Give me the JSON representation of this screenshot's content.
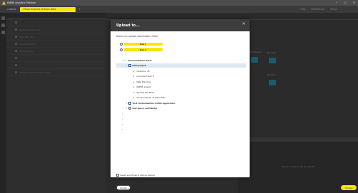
{
  "app": {
    "title": "KNIME Analytics Platform",
    "window_controls": [
      "–",
      "□",
      "✕"
    ]
  },
  "tabbar": {
    "home": "⌂ Home",
    "active_tab": "Visual Analysis of Sales Data",
    "plus": "+",
    "help": "Help",
    "preferences": "Preferences",
    "menu": "Menu"
  },
  "modal": {
    "title": "Upload to...",
    "close": "✕",
    "subtitle": "Select an upload destination folder",
    "tree": [
      {
        "level": 0,
        "chevron": "›",
        "icon": "globe",
        "label": "Hub 1",
        "highlight": true
      },
      {
        "level": 0,
        "chevron": "⌄",
        "icon": "globe",
        "label": "Hub 2",
        "highlight": true
      },
      {
        "level": 1,
        "chevron": "›",
        "icon": "",
        "label": ""
      },
      {
        "level": 1,
        "chevron": "⌄",
        "icon": "team",
        "label": "Documentation team",
        "bold": true
      },
      {
        "level": 2,
        "chevron": "⌄",
        "icon": "proj",
        "label": "Data project",
        "bold": true,
        "selected": true
      },
      {
        "level": 3,
        "chevron": "",
        "icon": "wf",
        "label": "Customer 45"
      },
      {
        "level": 3,
        "chevron": "",
        "icon": "wf",
        "label": "Count and Sum 4"
      },
      {
        "level": 3,
        "chevron": "",
        "icon": "wf",
        "label": "Data Blending"
      },
      {
        "level": 3,
        "chevron": "",
        "icon": "wf",
        "label": "KNIME_project"
      },
      {
        "level": 3,
        "chevron": "",
        "icon": "wf",
        "label": "My First Workflow"
      },
      {
        "level": 3,
        "chevron": "",
        "icon": "wf",
        "label": "Visual Analysis of Sales Data"
      },
      {
        "level": 2,
        "chevron": "›",
        "icon": "proj",
        "label": "Text Customization Profile Application",
        "bold": true
      },
      {
        "level": 2,
        "chevron": "›",
        "icon": "space",
        "label": "test space contributor",
        "bold": true
      },
      {
        "level": 1,
        "chevron": "›",
        "icon": "",
        "label": ""
      },
      {
        "level": 1,
        "chevron": "›",
        "icon": "",
        "label": ""
      },
      {
        "level": 1,
        "chevron": "›",
        "icon": "",
        "label": ""
      },
      {
        "level": 1,
        "chevron": "›",
        "icon": "",
        "label": ""
      }
    ],
    "reset_checkbox_label": "Reset workflow(s) before upload",
    "cancel_label": "Cancel",
    "choose_label": "Choose"
  },
  "background": {
    "explorer_rows": [
      "",
      "Relational Data Set",
      "Data Blending",
      "Count and Sum",
      "My Workflow",
      "",
      "",
      "Visual Analysis of Sales Data"
    ],
    "canvas_nodes": [
      "Excel Reader",
      "Row Filter",
      "Bar Chart"
    ],
    "bottom_panel_text": "Select a node to see its results."
  }
}
